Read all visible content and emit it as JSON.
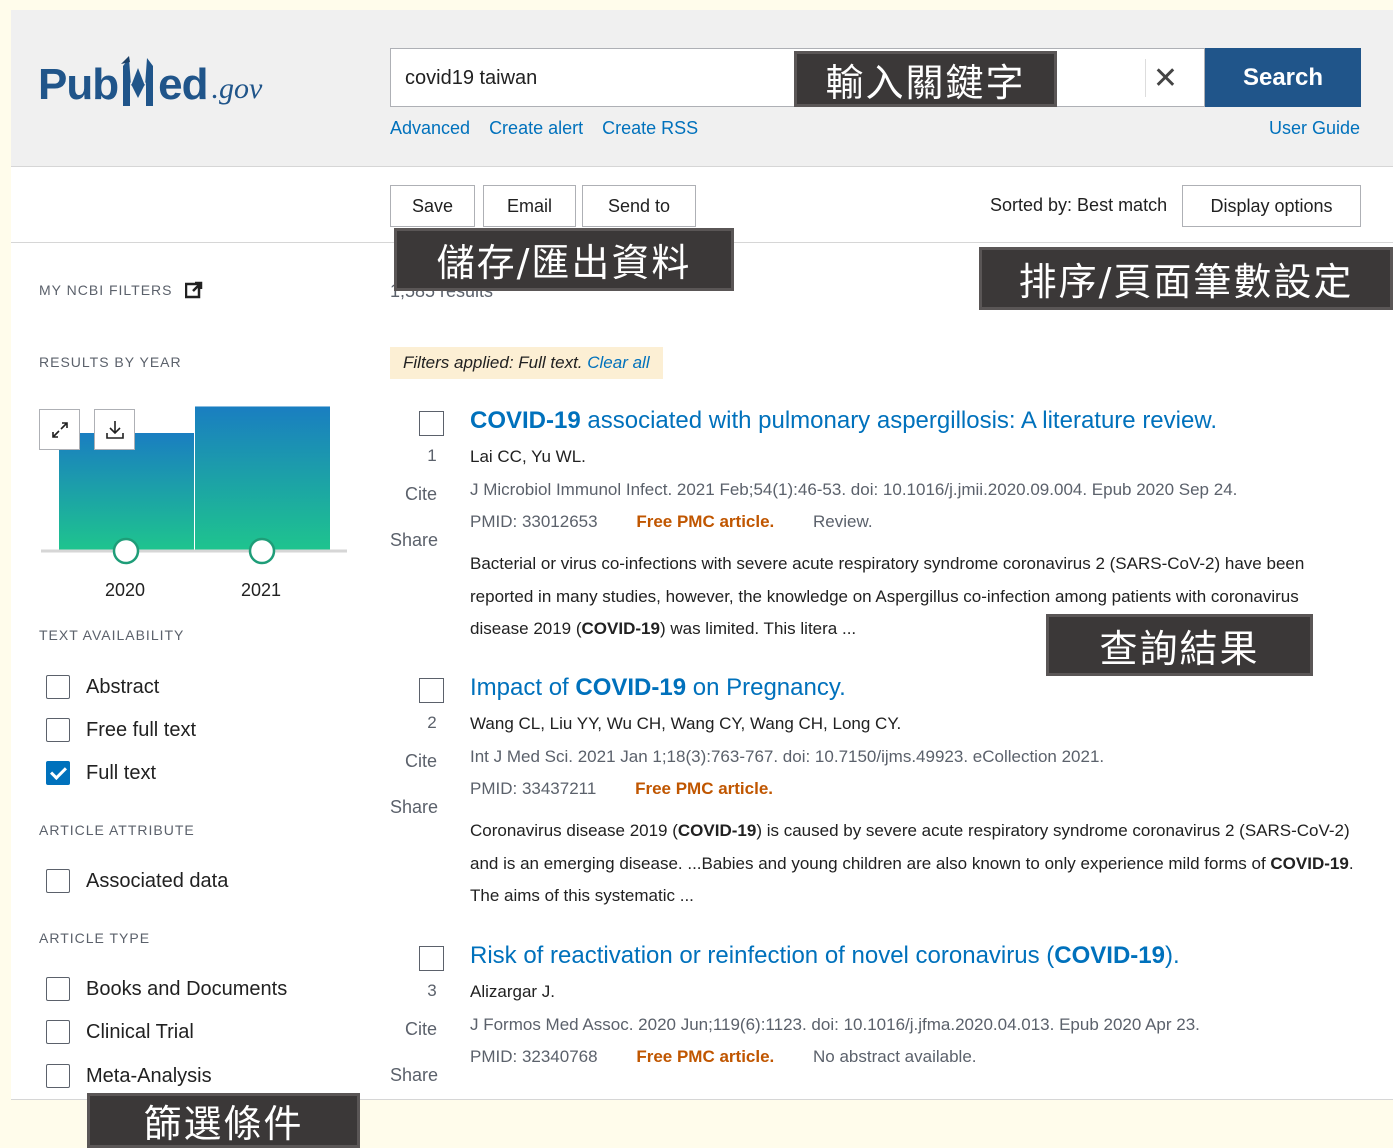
{
  "header": {
    "logo": {
      "pub": "Pub",
      "m": "M",
      "ed": "ed",
      "gov": ".gov"
    },
    "search_value": "covid19 taiwan",
    "clear_label": "✕",
    "search_button": "Search",
    "links": [
      "Advanced",
      "Create alert",
      "Create RSS"
    ],
    "user_guide": "User Guide"
  },
  "toolbar": {
    "save": "Save",
    "email": "Email",
    "send_to": "Send to",
    "sorted_by": "Sorted by: Best match",
    "display_options": "Display options"
  },
  "sidebar": {
    "my_ncbi_filters": "MY NCBI FILTERS",
    "results_by_year": "RESULTS BY YEAR",
    "histogram": {
      "years": [
        "2020",
        "2021"
      ],
      "relative_values": [
        0.75,
        0.92
      ],
      "expand_icon": "expand-icon",
      "download_icon": "download-icon"
    },
    "text_availability": {
      "heading": "TEXT AVAILABILITY",
      "items": [
        {
          "label": "Abstract",
          "checked": false
        },
        {
          "label": "Free full text",
          "checked": false
        },
        {
          "label": "Full text",
          "checked": true
        }
      ]
    },
    "article_attribute": {
      "heading": "ARTICLE ATTRIBUTE",
      "items": [
        {
          "label": "Associated data",
          "checked": false
        }
      ]
    },
    "article_type": {
      "heading": "ARTICLE TYPE",
      "items": [
        {
          "label": "Books and Documents",
          "checked": false
        },
        {
          "label": "Clinical Trial",
          "checked": false
        },
        {
          "label": "Meta-Analysis",
          "checked": false
        }
      ]
    }
  },
  "results": {
    "count": "1,585 results",
    "filters_applied": "Filters applied: Full text.",
    "clear_all": "Clear all",
    "cite": "Cite",
    "share": "Share",
    "items": [
      {
        "num": "1",
        "title_bold": "COVID-19",
        "title_rest": " associated with pulmonary aspergillosis: A literature review.",
        "authors": "Lai CC, Yu WL.",
        "journal": "J Microbiol Immunol Infect. 2021 Feb;54(1):46-53. doi: 10.1016/j.jmii.2020.09.004. Epub 2020 Sep 24.",
        "pmid": "PMID: 33012653",
        "free": "Free PMC article.",
        "extra": "Review.",
        "snippet_a": "Bacterial or virus co-infections with severe acute respiratory syndrome coronavirus 2 (SARS-CoV-2) have been reported in many studies, however, the knowledge on Aspergillus co-infection among patients with coronavirus disease 2019 (",
        "snippet_bold": "COVID-19",
        "snippet_b": ") was limited. This litera ..."
      },
      {
        "num": "2",
        "title_pre": "Impact of ",
        "title_bold": "COVID-19",
        "title_rest": " on Pregnancy.",
        "authors": "Wang CL, Liu YY, Wu CH, Wang CY, Wang CH, Long CY.",
        "journal": "Int J Med Sci. 2021 Jan 1;18(3):763-767. doi: 10.7150/ijms.49923. eCollection 2021.",
        "pmid": "PMID: 33437211",
        "free": "Free PMC article.",
        "snippet_a": "Coronavirus disease 2019 (",
        "snippet_bold": "COVID-19",
        "snippet_b": ") is caused by severe acute respiratory syndrome coronavirus 2 (SARS-CoV-2) and is an emerging disease. ...Babies and young children are also known to only experience mild forms of ",
        "snippet_bold2": "COVID-19",
        "snippet_c": ". The aims of this systematic ..."
      },
      {
        "num": "3",
        "title_pre": "Risk of reactivation or reinfection of novel coronavirus (",
        "title_bold": "COVID-19",
        "title_rest": ").",
        "authors": "Alizargar J.",
        "journal": "J Formos Med Assoc. 2020 Jun;119(6):1123. doi: 10.1016/j.jfma.2020.04.013. Epub 2020 Apr 23.",
        "pmid": "PMID: 32340768",
        "free": "Free PMC article.",
        "extra": "No abstract available."
      }
    ]
  },
  "callouts": {
    "keyword": "輸入關鍵字",
    "save_export": "儲存/匯出資料",
    "sort_display": "排序/頁面筆數設定",
    "results": "查詢結果",
    "filters": "篩選條件"
  },
  "colors": {
    "brand": "#20558a",
    "link": "#0071bc",
    "free_pmc": "#c05600",
    "filter_bg": "#fcefd4",
    "callout_bg": "#3b3838",
    "histogram_top": "#1a7ec1",
    "histogram_bottom": "#1ec48e"
  }
}
